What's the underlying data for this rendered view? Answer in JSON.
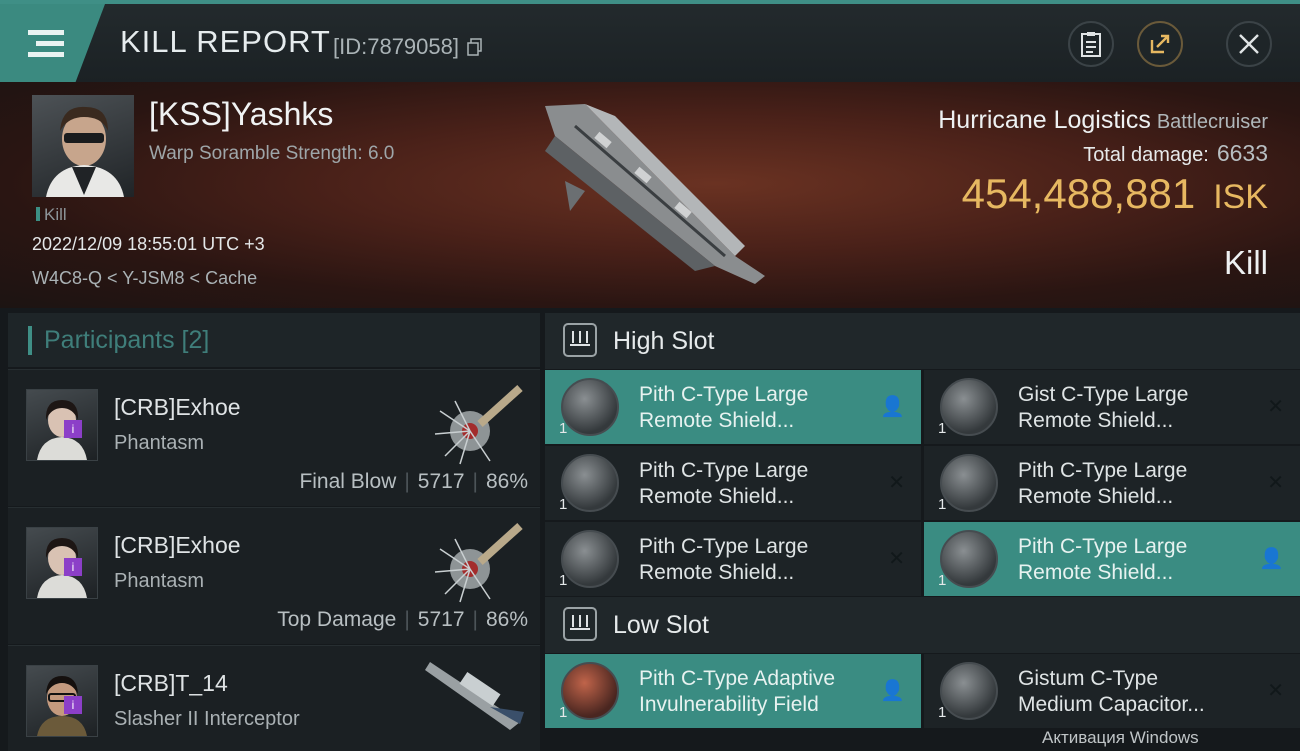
{
  "titlebar": {
    "title": "KILL REPORT",
    "id_text": "[ID:7879058]"
  },
  "victim": {
    "name": "[KSS]Yashks",
    "subtitle": "Warp Soramble Strength: 6.0",
    "tag": "Kill",
    "datetime": "2022/12/09 18:55:01 UTC +3",
    "location": "W4C8-Q < Y-JSM8 < Cache"
  },
  "ship": {
    "name": "Hurricane Logistics",
    "class": "Battlecruiser",
    "total_damage_label": "Total damage:",
    "total_damage": "6633",
    "isk_value": "454,488,881",
    "isk_unit": "ISK",
    "result": "Kill"
  },
  "participants": {
    "label": "Participants [2]",
    "rows": [
      {
        "name": "[CRB]Exhoe",
        "ship": "Phantasm",
        "role": "Final Blow",
        "damage": "5717",
        "percent": "86%"
      },
      {
        "name": "[CRB]Exhoe",
        "ship": "Phantasm",
        "role": "Top Damage",
        "damage": "5717",
        "percent": "86%"
      },
      {
        "name": "[CRB]T_14",
        "ship": "Slasher II Interceptor"
      }
    ]
  },
  "high_slot": {
    "label": "High Slot",
    "modules": [
      {
        "line1": "Pith C-Type Large",
        "line2": "Remote Shield...",
        "qty": "1"
      },
      {
        "line1": "Gist C-Type Large",
        "line2": "Remote Shield...",
        "qty": "1"
      },
      {
        "line1": "Pith C-Type Large",
        "line2": "Remote Shield...",
        "qty": "1"
      },
      {
        "line1": "Pith C-Type Large",
        "line2": "Remote Shield...",
        "qty": "1"
      },
      {
        "line1": "Pith C-Type Large",
        "line2": "Remote Shield...",
        "qty": "1"
      },
      {
        "line1": "Pith C-Type Large",
        "line2": "Remote Shield...",
        "qty": "1"
      }
    ]
  },
  "low_slot": {
    "label": "Low Slot",
    "modules": [
      {
        "line1": "Pith C-Type Adaptive",
        "line2": "Invulnerability Field",
        "qty": "1"
      },
      {
        "line1": "Gistum C-Type",
        "line2": "Medium Capacitor...",
        "qty": "1"
      }
    ]
  },
  "watermark": "Активация Windows",
  "colors": {
    "accent": "#3b8a80",
    "isk": "#e7b861",
    "badge": "#8c3fc8"
  }
}
